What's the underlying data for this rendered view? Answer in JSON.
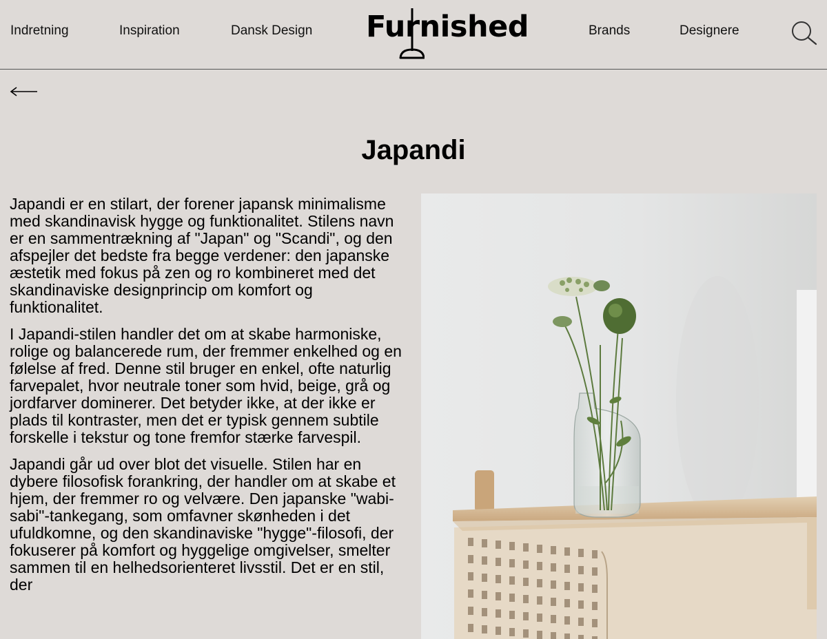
{
  "nav": {
    "left": [
      "Indretning",
      "Inspiration",
      "Dansk Design"
    ],
    "right": [
      "Brands",
      "Designere"
    ]
  },
  "logo": {
    "text": "Furnished"
  },
  "icons": {
    "search": "search-icon",
    "back": "back-arrow-icon"
  },
  "article": {
    "title": "Japandi",
    "paragraphs": [
      "Japandi er en stilart, der forener japansk minimalisme med skandinavisk hygge og funktionalitet. Stilens navn er en sammentrækning af \"Japan\" og \"Scandi\", og den afspejler det bedste fra begge verdener: den japanske æstetik med fokus på zen og ro kombineret med det skandinaviske designprincip om komfort og funktionalitet.",
      "I Japandi-stilen handler det om at skabe harmoniske, rolige og balancerede rum, der fremmer enkelhed og en følelse af fred. Denne stil bruger en enkel, ofte naturlig farvepalet, hvor neutrale toner som hvid, beige, grå og jordfarver dominerer. Det betyder ikke, at der ikke er plads til kontraster, men det er typisk gennem subtile forskelle i tekstur og tone fremfor stærke farvespil.",
      "Japandi går ud over blot det visuelle. Stilen har en dybere filosofisk forankring, der handler om at skabe et hjem, der fremmer ro og velvære. Den japanske \"wabi-sabi\"-tankegang, som omfavner skønheden i det ufuldkomne, og den skandinaviske \"hygge\"-filosofi, der fokuserer på komfort og hyggelige omgivelser, smelter sammen til en helhedsorienteret livsstil. Det er en stil, der"
    ]
  },
  "colors": {
    "background": "#dedad7",
    "text": "#000000",
    "divider": "#555555"
  }
}
